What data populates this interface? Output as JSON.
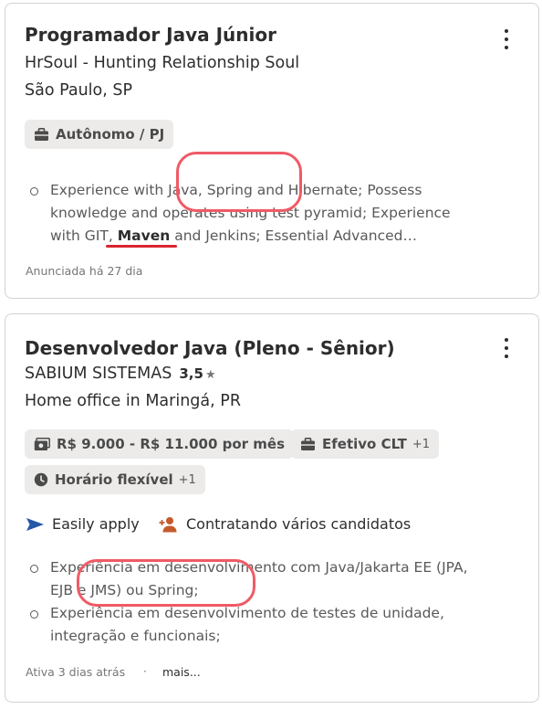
{
  "jobs": [
    {
      "title": "Programador Java Júnior",
      "company": "HrSoul - Hunting Relationship Soul",
      "location": "São Paulo, SP",
      "chips": [
        {
          "icon": "briefcase-icon",
          "label": "Autônomo / PJ"
        }
      ],
      "bullet_1a": "Experience with Java, Spring and Hibernate; Possess",
      "bullet_1b": "knowledge and operates using test pyramid; Experience",
      "bullet_1c_pre": "with GIT, ",
      "bullet_1c_bold": "Maven",
      "bullet_1c_post": " and Jenkins; Essential Advanced…",
      "posted": "Anunciada há 27 dia"
    },
    {
      "title": "Desenvolvedor Java (Pleno - Sênior)",
      "company": "SABIUM SISTEMAS",
      "rating": "3,5",
      "rating_star": "★",
      "location": "Home office in Maringá, PR",
      "chips": [
        {
          "icon": "money-icon",
          "label": "R$ 9.000 - R$ 11.000 por mês"
        },
        {
          "icon": "briefcase-icon",
          "label": "Efetivo CLT",
          "more": "+1"
        },
        {
          "icon": "clock-icon",
          "label": "Horário flexível",
          "more": "+1"
        }
      ],
      "features": [
        {
          "icon": "send-icon",
          "label": "Easily apply"
        },
        {
          "icon": "add-person-icon",
          "label": "Contratando vários candidatos"
        }
      ],
      "bullet_1a": "Experiência em desenvolvimento com Java/Jakarta EE (JPA,",
      "bullet_1b": "EJB e JMS) ou Spring;",
      "bullet_2a": "Experiência em desenvolvimento de testes de unidade,",
      "bullet_2b": "integração e funcionais;",
      "posted": "Ativa 3 dias atrás",
      "separator": "·",
      "more_link": "mais..."
    }
  ],
  "colors": {
    "annotation": "#f05a65",
    "underline": "#d9252f",
    "send_icon": "#2557a7",
    "person_icon": "#c45a2c"
  }
}
